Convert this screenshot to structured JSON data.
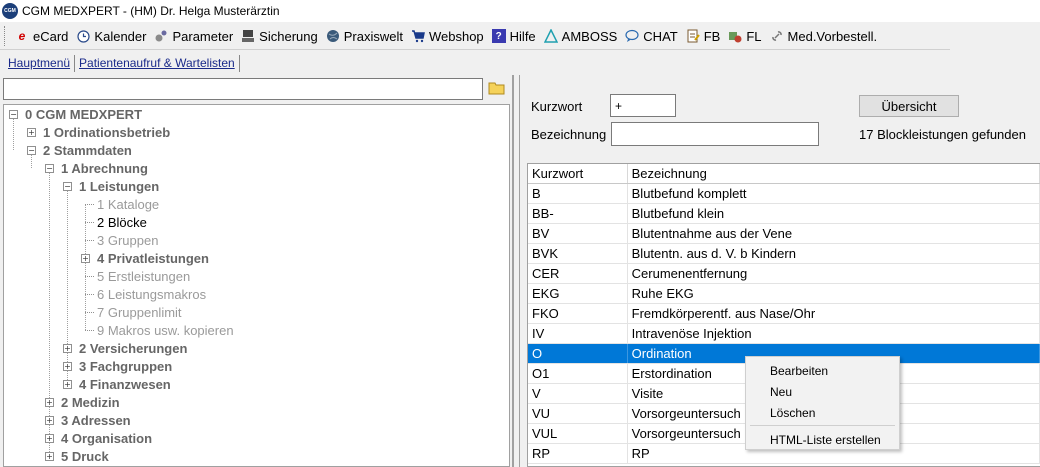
{
  "window": {
    "title": "CGM MEDXPERT - (HM) Dr. Helga Musterärztin",
    "logo_text": "CGM"
  },
  "toolbar": {
    "items": [
      {
        "label": "eCard",
        "icon": "ecard-icon",
        "color": "#d00000"
      },
      {
        "label": "Kalender",
        "icon": "clock-icon",
        "color": "#2a4a8a"
      },
      {
        "label": "Parameter",
        "icon": "parameter-icon",
        "color": "#555555"
      },
      {
        "label": "Sicherung",
        "icon": "backup-icon",
        "color": "#333333"
      },
      {
        "label": "Praxiswelt",
        "icon": "globe-icon",
        "color": "#2a4a6a"
      },
      {
        "label": "Webshop",
        "icon": "cart-icon",
        "color": "#1a3a8a"
      },
      {
        "label": "Hilfe",
        "icon": "help-icon",
        "color": "#3a3ab0"
      },
      {
        "label": "AMBOSS",
        "icon": "amboss-icon",
        "color": "#20a0b0"
      },
      {
        "label": "CHAT",
        "icon": "chat-icon",
        "color": "#2a6ab0"
      },
      {
        "label": "FB",
        "icon": "form-icon",
        "color": "#7a5a30"
      },
      {
        "label": "FL",
        "icon": "pills-icon",
        "color": "#b04030"
      },
      {
        "label": "Med.Vorbestell.",
        "icon": "link-icon",
        "color": "#777777"
      }
    ]
  },
  "tabs": [
    {
      "label": "Hauptmenü"
    },
    {
      "label": "Patientenaufruf & Wartelisten"
    }
  ],
  "search": {
    "value": ""
  },
  "tree": {
    "nodes": [
      {
        "label": "0 CGM MEDXPERT",
        "state": "minus",
        "style": "bold"
      },
      {
        "label": "1 Ordinationsbetrieb",
        "state": "plus",
        "style": "bold"
      },
      {
        "label": "2 Stammdaten",
        "state": "minus",
        "style": "bold"
      },
      {
        "label": "1 Abrechnung",
        "state": "minus",
        "style": "bold"
      },
      {
        "label": "1 Leistungen",
        "state": "minus",
        "style": "bold"
      },
      {
        "label": "1 Kataloge",
        "state": "leaf",
        "style": "gray"
      },
      {
        "label": "2 Blöcke",
        "state": "leaf",
        "style": "dark"
      },
      {
        "label": "3 Gruppen",
        "state": "leaf",
        "style": "gray"
      },
      {
        "label": "4 Privatleistungen",
        "state": "plus",
        "style": "bold"
      },
      {
        "label": "5 Erstleistungen",
        "state": "leaf",
        "style": "gray"
      },
      {
        "label": "6 Leistungsmakros",
        "state": "leaf",
        "style": "gray"
      },
      {
        "label": "7 Gruppenlimit",
        "state": "leaf",
        "style": "gray"
      },
      {
        "label": "9 Makros usw. kopieren",
        "state": "leaf",
        "style": "gray"
      },
      {
        "label": "2 Versicherungen",
        "state": "plus",
        "style": "bold"
      },
      {
        "label": "3 Fachgruppen",
        "state": "plus",
        "style": "bold"
      },
      {
        "label": "4 Finanzwesen",
        "state": "plus",
        "style": "bold"
      },
      {
        "label": "2 Medizin",
        "state": "plus",
        "style": "bold"
      },
      {
        "label": "3 Adressen",
        "state": "plus",
        "style": "bold"
      },
      {
        "label": "4 Organisation",
        "state": "plus",
        "style": "bold"
      },
      {
        "label": "5 Druck",
        "state": "plus",
        "style": "bold"
      }
    ]
  },
  "form": {
    "kurzwort_label": "Kurzwort",
    "kurzwort_value": "+",
    "bezeichnung_label": "Bezeichnung",
    "bezeichnung_value": "",
    "overview_button": "Übersicht",
    "result_text": "17 Blockleistungen gefunden"
  },
  "table": {
    "columns": [
      "Kurzwort",
      "Bezeichnung"
    ],
    "rows": [
      [
        "B",
        "Blutbefund komplett"
      ],
      [
        "BB-",
        "Blutbefund klein"
      ],
      [
        "BV",
        "Blutentnahme aus der Vene"
      ],
      [
        "BVK",
        "Blutentn. aus d. V. b Kindern"
      ],
      [
        "CER",
        "Cerumenentfernung"
      ],
      [
        "EKG",
        "Ruhe EKG"
      ],
      [
        "FKO",
        "Fremdkörperentf. aus Nase/Ohr"
      ],
      [
        "IV",
        "Intravenöse Injektion"
      ],
      [
        "O",
        "Ordination"
      ],
      [
        "O1",
        "Erstordination"
      ],
      [
        "V",
        "Visite"
      ],
      [
        "VU",
        "Vorsorgeuntersuch"
      ],
      [
        "VUL",
        "Vorsorgeuntersuch"
      ],
      [
        "RP",
        "RP"
      ]
    ],
    "selected_row": 8,
    "selection_color": "#0078d7"
  },
  "context_menu": {
    "items": [
      "Bearbeiten",
      "Neu",
      "Löschen",
      "HTML-Liste erstellen"
    ]
  }
}
